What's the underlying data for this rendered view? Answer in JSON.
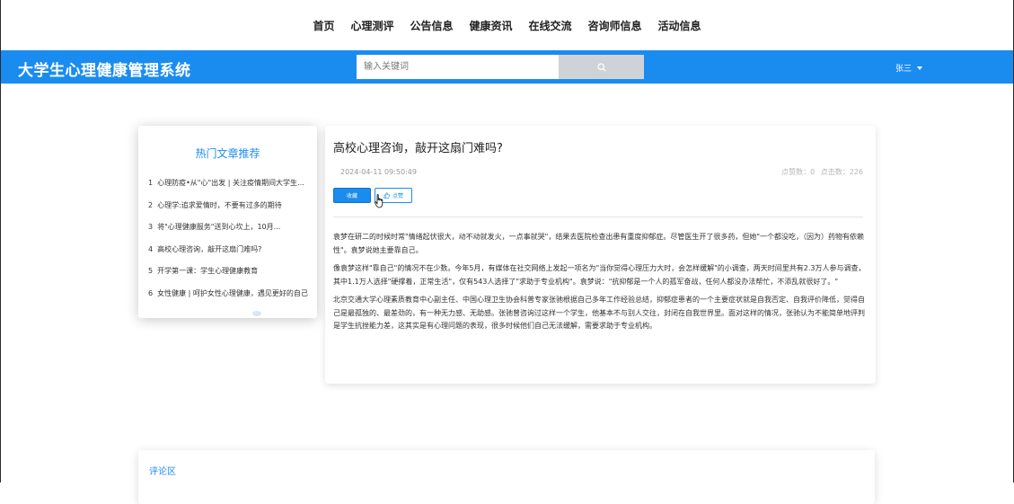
{
  "nav": {
    "items": [
      "首页",
      "心理测评",
      "公告信息",
      "健康资讯",
      "在线交流",
      "咨询师信息",
      "活动信息"
    ]
  },
  "header": {
    "brand": "大学生心理健康管理系统",
    "search_placeholder": "输入关键词",
    "search_icon": "search-icon",
    "user_name": "张三",
    "accent_color": "#1a8cf0"
  },
  "hot": {
    "title": "热门文章推荐",
    "items": [
      {
        "num": "1",
        "label": "心理防疫•从\"心\"出发 | 关注疫情期间大学生心理健康"
      },
      {
        "num": "2",
        "label": "心理学:追求爱情时，不要有过多的期待"
      },
      {
        "num": "3",
        "label": "将\"心理健康服务\"送到心坎上，10月..."
      },
      {
        "num": "4",
        "label": "高校心理咨询，敲开这扇门难吗?"
      },
      {
        "num": "5",
        "label": "开学第一课：学生心理健康教育"
      },
      {
        "num": "6",
        "label": "女性健康 | 呵护女性心理健康，遇见更好的自己"
      }
    ]
  },
  "article": {
    "title": "高校心理咨询，敲开这扇门难吗?",
    "date": "2024-04-11 09:50:49",
    "likes_label": "点赞数：0",
    "clicks_label": "点击数：226",
    "fav_label": "收藏",
    "like_label": "点赞",
    "paragraphs": [
      "袁梦在研二的时候时常\"情绪起伏很大，动不动就发火，一点事就哭\"，结果去医院检查出患有重度抑郁症。尽管医生开了很多药，但她\"一个都没吃，（因为）药物有依赖性\"。袁梦说她主要靠自己。",
      "像袁梦这样\"靠自己\"的情况不在少数。今年5月，有媒体在社交网络上发起一项名为\"当你觉得心理压力大时，会怎样缓解\"的小调查，两天时间里共有2.3万人参与调查，其中1.1万人选择\"硬撑着，正常生活\"，仅有543人选择了\"求助于专业机构\"。袁梦说：\"抗抑郁是一个人的孤军奋战，任何人都没办法帮忙，不添乱就很好了。\"",
      "北京交通大学心理素质教育中心副主任、中国心理卫生协会科普专家张驰根据自己多年工作经验总结，抑郁症患者的一个主要症状就是自我否定、自我评价降低，觉得自己是最孤独的、最差劲的，有一种无力感、无助感。张驰曾咨询过这样一个学生，他基本不与别人交往，封闭在自我世界里。面对这样的情况，张驰认为不能简单地评判是学生抗挫能力差，这其实是有心理问题的表现，很多时候他们自己无法缓解，需要求助于专业机构。"
    ]
  },
  "comment": {
    "title": "评论区"
  }
}
